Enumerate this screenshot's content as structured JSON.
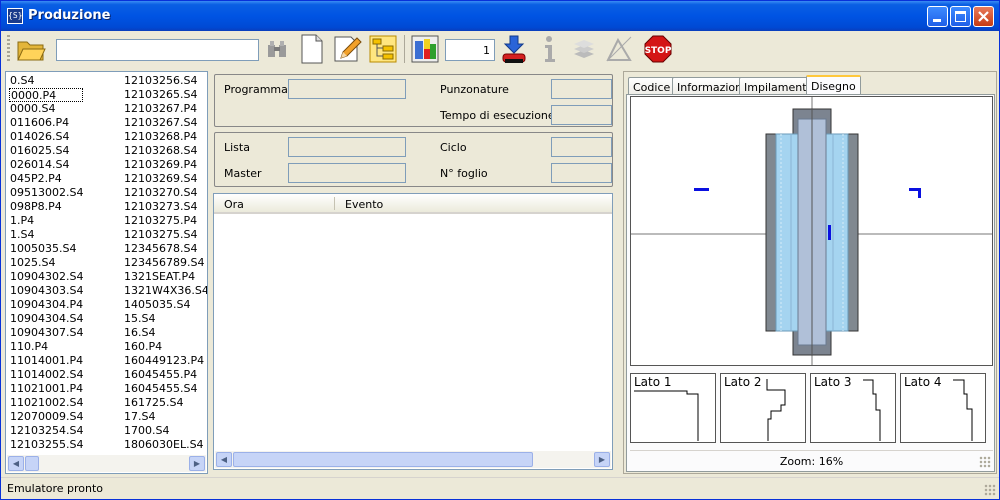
{
  "window": {
    "title": "Produzione",
    "app_icon": "{S}"
  },
  "toolbar": {
    "counter_value": "1"
  },
  "files": {
    "col1": [
      "0.S4",
      "0000.P4",
      "0000.S4",
      "011606.P4",
      "014026.S4",
      "016025.S4",
      "026014.S4",
      "045P2.P4",
      "09513002.S4",
      "098P8.P4",
      "1.P4",
      "1.S4",
      "1005035.S4",
      "1025.S4",
      "10904302.S4",
      "10904303.S4",
      "10904304.P4",
      "10904304.S4",
      "10904307.S4",
      "110.P4",
      "11014001.P4",
      "11014002.S4",
      "11021001.P4",
      "11021002.S4",
      "12070009.S4",
      "12103254.S4",
      "12103255.S4"
    ],
    "col2": [
      "12103256.S4",
      "12103265.S4",
      "12103267.P4",
      "12103267.S4",
      "12103268.P4",
      "12103268.S4",
      "12103269.P4",
      "12103269.S4",
      "12103270.S4",
      "12103273.S4",
      "12103275.P4",
      "12103275.S4",
      "12345678.S4",
      "123456789.S4",
      "1321SEAT.P4",
      "1321W4X36.S4",
      "1405035.S4",
      "15.S4",
      "16.S4",
      "160.P4",
      "160449123.P4",
      "16045455.P4",
      "16045455.S4",
      "161725.S4",
      "17.S4",
      "1700.S4",
      "1806030EL.S4"
    ]
  },
  "info": {
    "programma": "Programma",
    "punzonature": "Punzonature",
    "tempo": "Tempo di esecuzione",
    "lista": "Lista",
    "ciclo": "Ciclo",
    "master": "Master",
    "foglio": "N° foglio"
  },
  "log": {
    "col_ora": "Ora",
    "col_evento": "Evento"
  },
  "tabs": [
    "Codice",
    "Informazioni",
    "Impilamento",
    "Disegno"
  ],
  "lati": [
    "Lato 1",
    "Lato 2",
    "Lato 3",
    "Lato 4"
  ],
  "zoom": "Zoom: 16%",
  "status": "Emulatore pronto"
}
